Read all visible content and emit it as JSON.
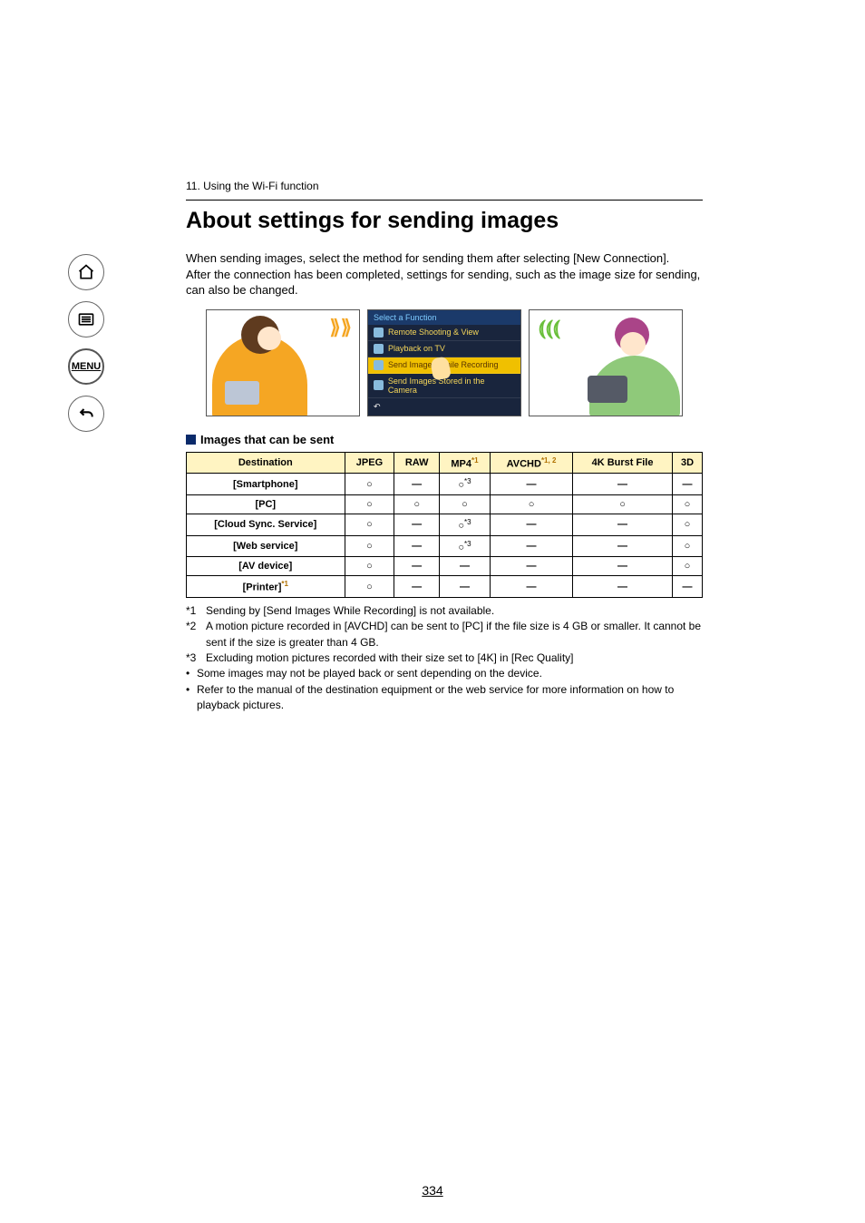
{
  "breadcrumb": "11. Using the Wi-Fi function",
  "title": "About settings for sending images",
  "intro": [
    "When sending images, select the method for sending them after selecting [New Connection].",
    "After the connection has been completed, settings for sending, such as the image size for sending, can also be changed."
  ],
  "panel2": {
    "header": "Select a Function",
    "items": [
      "Remote Shooting & View",
      "Playback on TV",
      "Send Images While Recording",
      "Send Images Stored in the Camera"
    ],
    "selected_index": 2
  },
  "section_header": "Images that can be sent",
  "table": {
    "columns": [
      "Destination",
      "JPEG",
      "RAW",
      "MP4",
      "AVCHD",
      "4K Burst File",
      "3D"
    ],
    "column_sups": [
      "",
      "",
      "",
      "*1",
      "*1, 2",
      "",
      ""
    ],
    "rows": [
      {
        "dest": "[Smartphone]",
        "dest_sup": "",
        "cells": [
          "○",
          "—",
          "○*3",
          "—",
          "—",
          "—"
        ]
      },
      {
        "dest": "[PC]",
        "dest_sup": "",
        "cells": [
          "○",
          "○",
          "○",
          "○",
          "○",
          "○"
        ]
      },
      {
        "dest": "[Cloud Sync. Service]",
        "dest_sup": "",
        "cells": [
          "○",
          "—",
          "○*3",
          "—",
          "—",
          "○"
        ]
      },
      {
        "dest": "[Web service]",
        "dest_sup": "",
        "cells": [
          "○",
          "—",
          "○*3",
          "—",
          "—",
          "○"
        ]
      },
      {
        "dest": "[AV device]",
        "dest_sup": "",
        "cells": [
          "○",
          "—",
          "—",
          "—",
          "—",
          "○"
        ]
      },
      {
        "dest": "[Printer]",
        "dest_sup": "*1",
        "cells": [
          "○",
          "—",
          "—",
          "—",
          "—",
          "—"
        ]
      }
    ]
  },
  "footnotes": [
    {
      "marker": "*1",
      "text": "Sending by [Send Images While Recording] is not available."
    },
    {
      "marker": "*2",
      "text": "A motion picture recorded in [AVCHD] can be sent to [PC] if the file size is 4 GB or smaller. It cannot be sent if the size is greater than 4 GB."
    },
    {
      "marker": "*3",
      "text": "Excluding motion pictures recorded with their size set to [4K] in [Rec Quality]"
    }
  ],
  "bullets": [
    "Some images may not be played back or sent depending on the device.",
    "Refer to the manual of the destination equipment or the web service for more information on how to playback pictures."
  ],
  "page_number": "334",
  "sidebar_menu": "MENU"
}
